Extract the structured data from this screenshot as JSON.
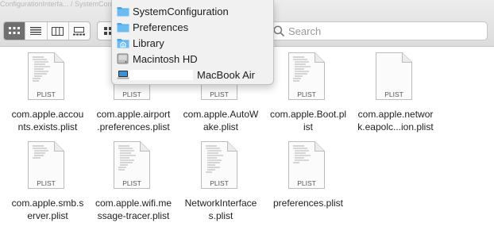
{
  "toolbar": {
    "title_fragment": "ConfigurationInterfa... / SystemConfiguration",
    "view_modes": [
      "icon-view",
      "list-view",
      "column-view",
      "gallery-view"
    ],
    "search_placeholder": "Search"
  },
  "path_menu": {
    "items": [
      {
        "label": "SystemConfiguration",
        "icon": "folder-icon"
      },
      {
        "label": "Preferences",
        "icon": "folder-icon"
      },
      {
        "label": "Library",
        "icon": "library-folder-icon"
      },
      {
        "label": "Macintosh HD",
        "icon": "hard-drive-icon"
      },
      {
        "label": "MacBook Air",
        "icon": "laptop-icon"
      }
    ]
  },
  "files": [
    {
      "line1": "com.apple.accou",
      "line2": "nts.exists.plist",
      "badge": "PLIST"
    },
    {
      "line1": "com.apple.airport",
      "line2": ".preferences.plist",
      "badge": "PLIST"
    },
    {
      "line1": "com.apple.AutoW",
      "line2": "ake.plist",
      "badge": "PLIST"
    },
    {
      "line1": "com.apple.Boot.pl",
      "line2": "ist",
      "badge": "PLIST"
    },
    {
      "line1": "com.apple.networ",
      "line2": "k.eapolc...ion.plist",
      "badge": "PLIST"
    },
    {
      "line1": "com.apple.smb.s",
      "line2": "erver.plist",
      "badge": "PLIST"
    },
    {
      "line1": "com.apple.wifi.me",
      "line2": "ssage-tracer.plist",
      "badge": "PLIST"
    },
    {
      "line1": "NetworkInterface",
      "line2": "s.plist",
      "badge": "PLIST"
    },
    {
      "line1": "preferences.plist",
      "line2": "",
      "badge": "PLIST"
    }
  ]
}
